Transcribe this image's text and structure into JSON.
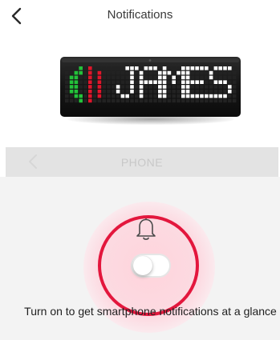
{
  "header": {
    "title": "Notifications",
    "back_icon": "chevron-left-icon"
  },
  "device_preview": {
    "display_text": "JAMES",
    "call_icon": "phone-ringing-icon",
    "colors": {
      "phone": "#23c23a",
      "waves": "#e0152b",
      "text": "#ffffff",
      "body": "#1b1b1b"
    }
  },
  "section": {
    "label": "PHONE",
    "back_icon": "chevron-left-icon"
  },
  "setting": {
    "icon": "bell-icon",
    "toggle_on": false,
    "description": "Turn on to get smartphone notifications at a glance"
  },
  "colors": {
    "highlight_ring": "#e3173d",
    "tab_bg": "#e3e3e3",
    "settings_bg": "#f3f3f3"
  }
}
